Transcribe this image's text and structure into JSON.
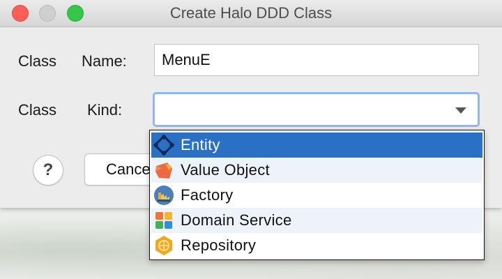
{
  "window": {
    "title": "Create Halo DDD Class"
  },
  "form": {
    "name_label_1": "Class",
    "name_label_2": "Name:",
    "name_value": "MenuE",
    "kind_label_1": "Class",
    "kind_label_2": "Kind:",
    "kind_value": ""
  },
  "buttons": {
    "help": "?",
    "cancel": "Cancel"
  },
  "dropdown": {
    "selected_index": 0,
    "items": [
      {
        "label": "Entity",
        "icon": "entity-icon"
      },
      {
        "label": "Value Object",
        "icon": "value-object-icon"
      },
      {
        "label": "Factory",
        "icon": "factory-icon"
      },
      {
        "label": "Domain Service",
        "icon": "domain-service-icon"
      },
      {
        "label": "Repository",
        "icon": "repository-icon"
      }
    ]
  },
  "colors": {
    "selection": "#2a70c5",
    "alt_row": "#eef3fb",
    "focus_ring": "#8fb6ee"
  }
}
